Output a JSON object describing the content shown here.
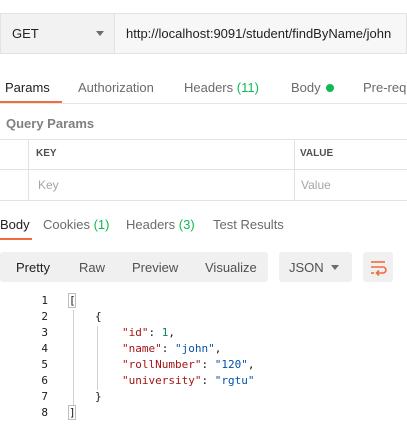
{
  "request": {
    "method": "GET",
    "url": "http://localhost:9091/student/findByName/john"
  },
  "request_tabs": {
    "params": "Params",
    "authorization": "Authorization",
    "headers_label": "Headers",
    "headers_count": "(11)",
    "body": "Body",
    "pre_request": "Pre-requ"
  },
  "query_params": {
    "title": "Query Params",
    "col_key": "KEY",
    "col_value": "VALUE",
    "key_placeholder": "Key",
    "value_placeholder": "Value"
  },
  "response_tabs": {
    "body": "Body",
    "cookies_label": "Cookies",
    "cookies_count": "(1)",
    "headers_label": "Headers",
    "headers_count": "(3)",
    "test_results": "Test Results"
  },
  "view_toolbar": {
    "pretty": "Pretty",
    "raw": "Raw",
    "preview": "Preview",
    "visualize": "Visualize",
    "format": "JSON"
  },
  "response_body": {
    "line_numbers": [
      "1",
      "2",
      "3",
      "4",
      "5",
      "6",
      "7",
      "8"
    ],
    "open_bracket": "[",
    "open_brace": "{",
    "id_key": "\"id\"",
    "id_value": "1",
    "name_key": "\"name\"",
    "name_value": "\"john\"",
    "roll_key": "\"rollNumber\"",
    "roll_value": "\"120\"",
    "univ_key": "\"university\"",
    "univ_value": "\"rgtu\"",
    "close_brace": "}",
    "close_bracket": "]"
  },
  "colors": {
    "accent": "#f26b3a",
    "count_green": "#0cbb52"
  }
}
